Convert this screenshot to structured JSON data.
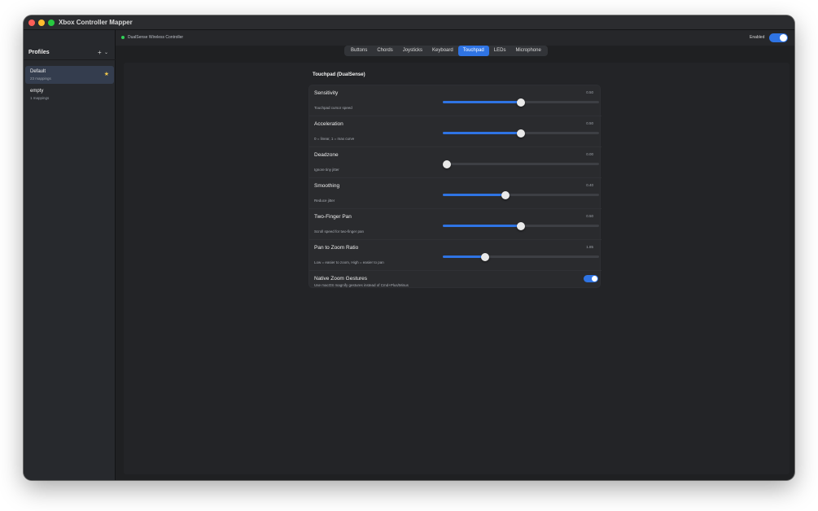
{
  "window": {
    "title": "Xbox Controller Mapper"
  },
  "sidebar": {
    "header": "Profiles",
    "add_label": "+",
    "menu_label": "⌄",
    "profiles": [
      {
        "name": "Default",
        "mappings": "23 mappings",
        "selected": true,
        "starred": true
      },
      {
        "name": "empty",
        "mappings": "1 mappings",
        "selected": false,
        "starred": false
      }
    ]
  },
  "topbar": {
    "controller_name": "DualSense Wireless Controller",
    "connected": true,
    "enabled_label": "Enabled",
    "enabled": true
  },
  "tabs": [
    {
      "label": "Buttons",
      "active": false
    },
    {
      "label": "Chords",
      "active": false
    },
    {
      "label": "Joysticks",
      "active": false
    },
    {
      "label": "Keyboard",
      "active": false
    },
    {
      "label": "Touchpad",
      "active": true
    },
    {
      "label": "LEDs",
      "active": false
    },
    {
      "label": "Microphone",
      "active": false
    }
  ],
  "touchpad": {
    "title": "Touchpad (DualSense)",
    "settings": [
      {
        "label": "Sensitivity",
        "description": "Touchpad cursor speed",
        "value": "0.50",
        "fraction": 0.5
      },
      {
        "label": "Acceleration",
        "description": "0 = linear, 1 = max curve",
        "value": "0.50",
        "fraction": 0.5
      },
      {
        "label": "Deadzone",
        "description": "Ignore tiny jitter",
        "value": "0.00",
        "fraction": 0.0
      },
      {
        "label": "Smoothing",
        "description": "Reduce jitter",
        "value": "0.40",
        "fraction": 0.4
      },
      {
        "label": "Two-Finger Pan",
        "description": "Scroll speed for two-finger pan",
        "value": "0.50",
        "fraction": 0.5
      },
      {
        "label": "Pan to Zoom Ratio",
        "description": "Low = easier to zoom, High = easier to pan",
        "value": "1.85",
        "fraction": 0.27
      }
    ],
    "native_zoom": {
      "label": "Native Zoom Gestures",
      "description": "Use macOS magnify gestures instead of Cmd+Plus/Minus",
      "enabled": true
    }
  },
  "colors": {
    "accent": "#2f74e4",
    "star": "#f2c94c",
    "connected": "#30d158"
  }
}
